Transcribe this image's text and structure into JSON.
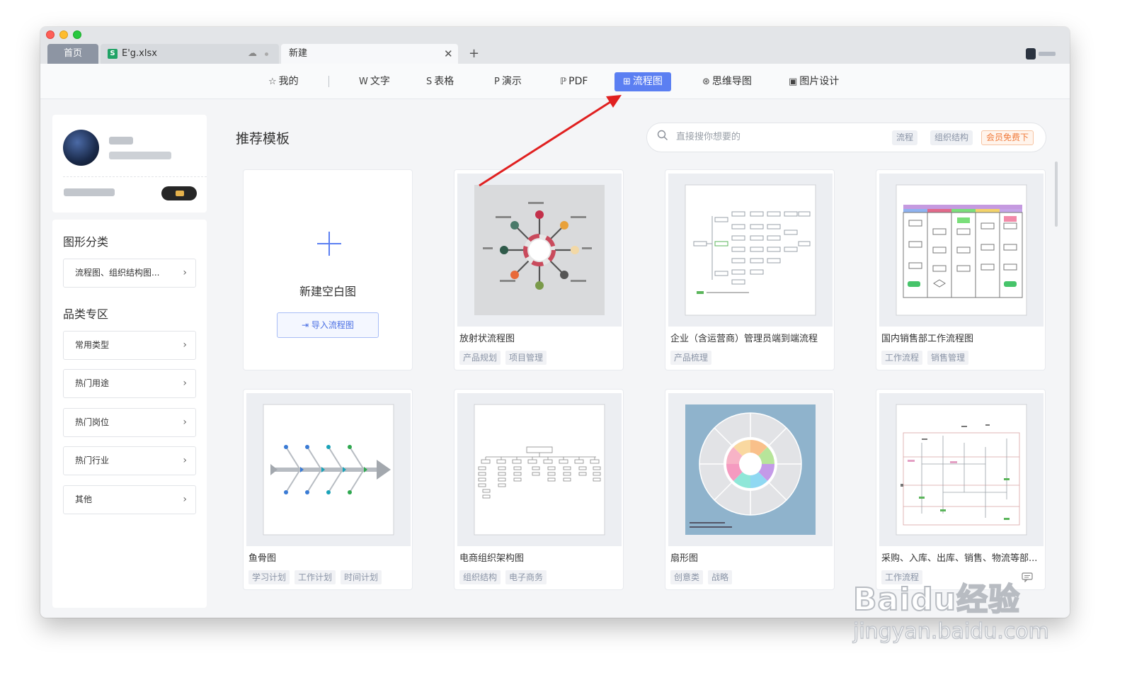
{
  "tabs": {
    "home": "首页",
    "file": "E'g.xlsx",
    "new": "新建"
  },
  "nav": {
    "items": [
      {
        "icon": "☆",
        "label": "我的"
      },
      {
        "icon": "W",
        "label": "文字"
      },
      {
        "icon": "S",
        "label": "表格"
      },
      {
        "icon": "P",
        "label": "演示"
      },
      {
        "icon": "ℙ",
        "label": "PDF"
      },
      {
        "icon": "⊞",
        "label": "流程图"
      },
      {
        "icon": "⊛",
        "label": "思维导图"
      },
      {
        "icon": "▣",
        "label": "图片设计"
      }
    ],
    "active": "流程图"
  },
  "sidebar": {
    "category_heading": "图形分类",
    "category_button": "流程图、组织结构图...",
    "zone_heading": "品类专区",
    "zone_items": [
      "常用类型",
      "热门用途",
      "热门岗位",
      "热门行业",
      "其他"
    ]
  },
  "main": {
    "title": "推荐模板",
    "search_placeholder": "直接搜你想要的",
    "search_chips": [
      "流程",
      "组织结构",
      "会员免费下"
    ],
    "new_card": {
      "label": "新建空白图",
      "import_label": "导入流程图"
    },
    "templates": [
      {
        "title": "放射状流程图",
        "tags": [
          "产品规划",
          "项目管理"
        ]
      },
      {
        "title": "企业（含运营商）管理员端到端流程",
        "tags": [
          "产品梳理"
        ]
      },
      {
        "title": "国内销售部工作流程图",
        "tags": [
          "工作流程",
          "销售管理"
        ]
      },
      {
        "title": "鱼骨图",
        "tags": [
          "学习计划",
          "工作计划",
          "时间计划"
        ]
      },
      {
        "title": "电商组织架构图",
        "tags": [
          "组织结构",
          "电子商务"
        ]
      },
      {
        "title": "扇形图",
        "tags": [
          "创意类",
          "战略"
        ]
      },
      {
        "title": "采购、入库、出库、销售、物流等部...",
        "tags": [
          "工作流程"
        ]
      }
    ]
  },
  "watermark": {
    "main": "Baidu经验",
    "sub": "jingyan.baidu.com"
  },
  "colors": {
    "accent": "#5b7ff2",
    "vip": "#f07a3a",
    "arrow": "#e02020"
  }
}
